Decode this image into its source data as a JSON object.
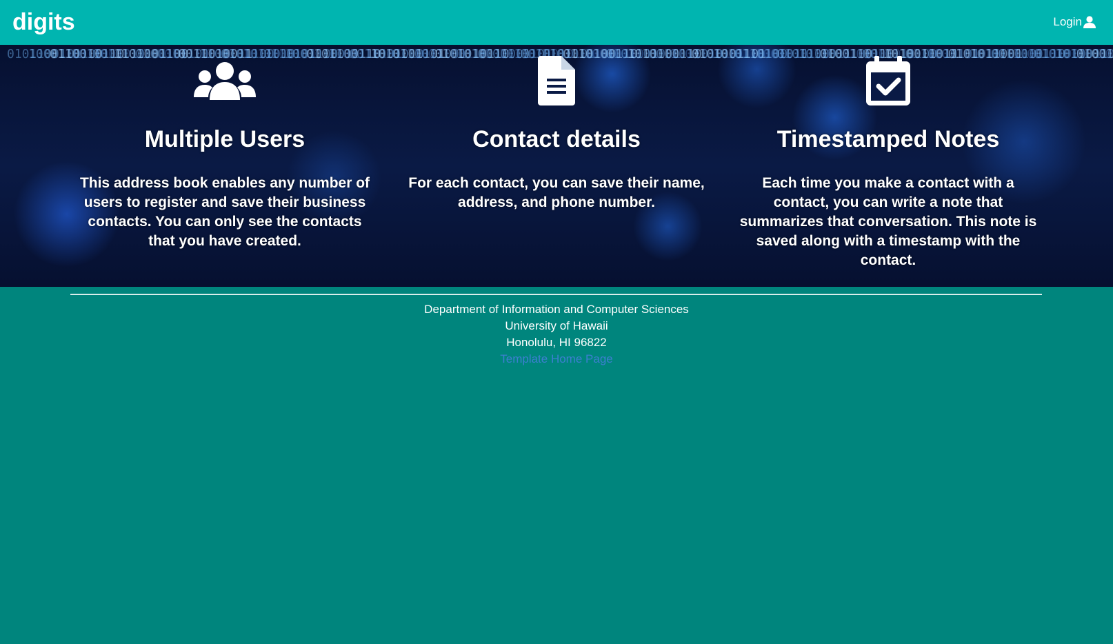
{
  "navbar": {
    "brand": "digits",
    "login_label": "Login",
    "login_icon": "user-icon"
  },
  "features": [
    {
      "icon": "users-icon",
      "title": "Multiple Users",
      "description": "This address book enables any number of users to register and save their business contacts. You can only see the contacts that you have created."
    },
    {
      "icon": "file-text-icon",
      "title": "Contact details",
      "description": "For each contact, you can save their name, address, and phone number."
    },
    {
      "icon": "calendar-check-icon",
      "title": "Timestamped Notes",
      "description": "Each time you make a contact with a contact, you can write a note that summarizes that conversation. This note is saved along with a timestamp with the contact."
    }
  ],
  "footer": {
    "line1": "Department of Information and Computer Sciences",
    "line2": "University of Hawaii",
    "line3": "Honolulu, HI 96822",
    "link_label": "Template Home Page"
  },
  "colors": {
    "navbar": "#00b5b0",
    "page_background": "#00857d",
    "link": "#3c7fd0"
  }
}
